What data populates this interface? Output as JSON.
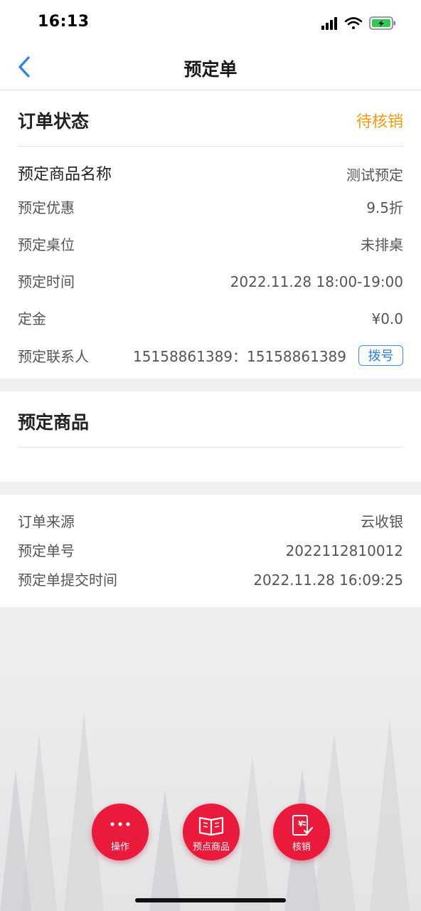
{
  "status_bar": {
    "time": "16:13"
  },
  "nav": {
    "title": "预定单"
  },
  "order_status": {
    "label": "订单状态",
    "value": "待核销"
  },
  "details": {
    "product_name": {
      "label": "预定商品名称",
      "value": "测试预定"
    },
    "discount": {
      "label": "预定优惠",
      "value": "9.5折"
    },
    "table": {
      "label": "预定桌位",
      "value": "未排桌"
    },
    "time": {
      "label": "预定时间",
      "value": "2022.11.28 18:00-19:00"
    },
    "deposit": {
      "label": "定金",
      "value": "¥0.0"
    },
    "contact": {
      "label": "预定联系人",
      "value": "15158861389：15158861389",
      "dial_label": "拨号"
    }
  },
  "products": {
    "title": "预定商品"
  },
  "order_info": {
    "source": {
      "label": "订单来源",
      "value": "云收银"
    },
    "number": {
      "label": "预定单号",
      "value": "2022112810012"
    },
    "submitted": {
      "label": "预定单提交时间",
      "value": "2022.11.28 16:09:25"
    }
  },
  "actions": {
    "operate": "操作",
    "add_items": "预点商品",
    "verify": "核销"
  },
  "colors": {
    "accent_red": "#ea1a3d",
    "status_orange": "#f19a12",
    "link_blue": "#2c7fd8"
  }
}
